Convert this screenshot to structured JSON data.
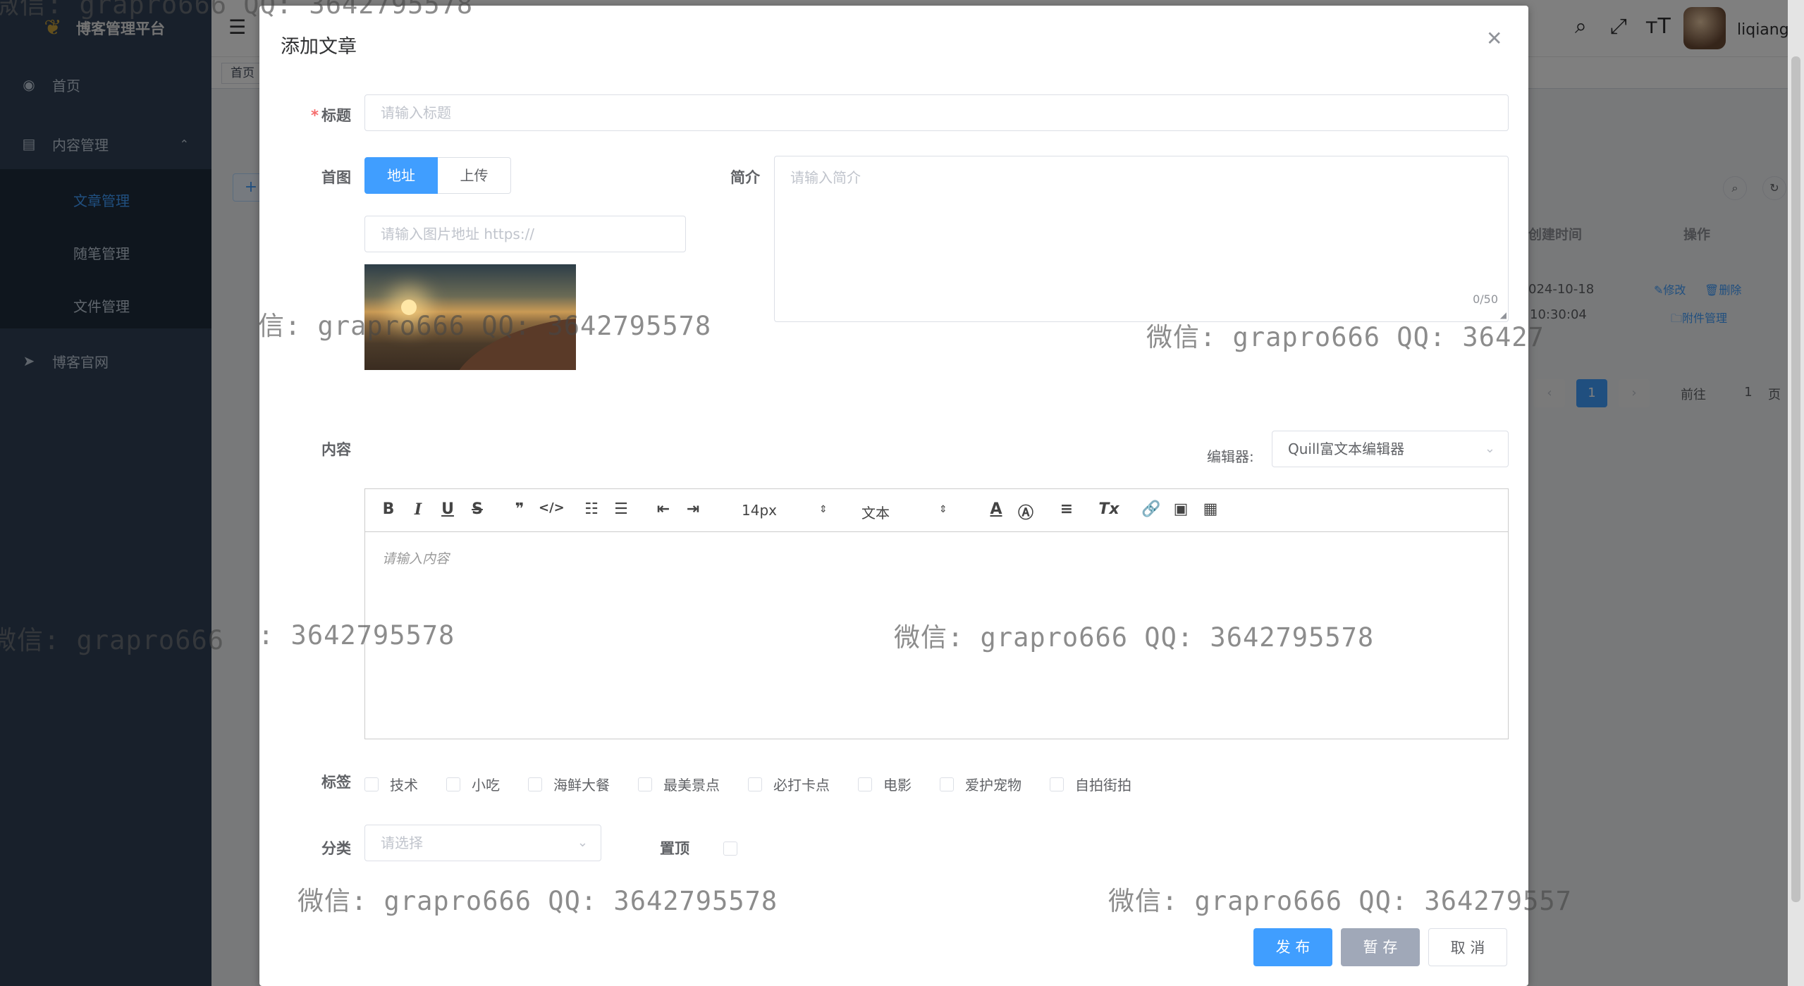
{
  "app": {
    "brand": "博客管理平台",
    "username": "liqiang"
  },
  "sidebar": {
    "items": [
      {
        "label": "首页",
        "icon": "dashboard-icon"
      },
      {
        "label": "内容管理",
        "icon": "document-icon"
      },
      {
        "label": "博客官网",
        "icon": "send-icon"
      }
    ],
    "subitems": [
      {
        "label": "文章管理",
        "active": true
      },
      {
        "label": "随笔管理",
        "active": false
      },
      {
        "label": "文件管理",
        "active": false
      }
    ]
  },
  "tags_bar": {
    "first_tag": "首页"
  },
  "table": {
    "col_created": "创建时间",
    "col_actions": "操作",
    "created_date": "024-10-18",
    "created_time": "10:30:04",
    "edit": "修改",
    "delete": "删除",
    "attachments": "附件管理"
  },
  "pagination": {
    "current": "1",
    "goto_label": "前往",
    "goto_value": "1",
    "page_suffix": "页"
  },
  "dialog": {
    "title": "添加文章",
    "title_label": "标题",
    "title_placeholder": "请输入标题",
    "cover_label": "首图",
    "cover_tabs": [
      "地址",
      "上传"
    ],
    "cover_placeholder": "请输入图片地址 https://",
    "summary_label": "简介",
    "summary_placeholder": "请输入简介",
    "summary_counter": "0/50",
    "content_label": "内容",
    "editor_label": "编辑器:",
    "editor_value": "Quill富文本编辑器",
    "toolbar": {
      "font_size": "14px",
      "header": "文本"
    },
    "content_placeholder": "请输入内容",
    "tags_label": "标签",
    "tags": [
      "技术",
      "小吃",
      "海鲜大餐",
      "最美景点",
      "必打卡点",
      "电影",
      "爱护宠物",
      "自拍街拍"
    ],
    "category_label": "分类",
    "category_placeholder": "请选择",
    "top_label": "置顶",
    "buttons": {
      "publish": "发 布",
      "draft": "暂 存",
      "cancel": "取 消"
    }
  },
  "watermarks": [
    "微信: grapro666 QQ: 3642795578",
    "信: grapro666 QQ: 3642795578",
    "微信: grapro666 QQ: 36427",
    "微信: grapro666",
    ": 3642795578",
    "微信: grapro666 QQ: 3642795578",
    "微信: grapro666 QQ: 3642795578",
    "微信: grapro666 QQ: 364279557"
  ],
  "colors": {
    "primary": "#409eff",
    "sidebar": "#304156",
    "submenu": "#1f2d3d",
    "danger": "#f56c6c"
  }
}
